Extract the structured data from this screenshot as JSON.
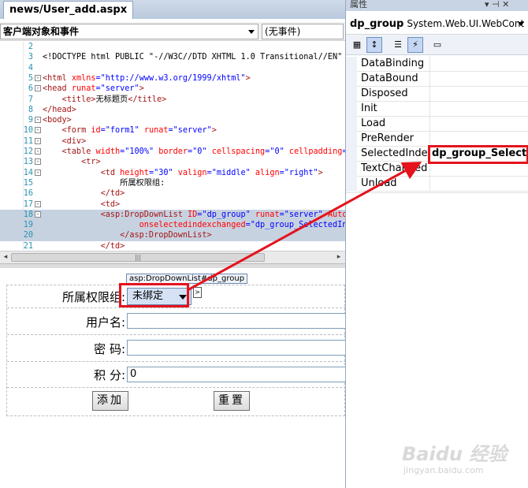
{
  "editor": {
    "tab_title": "news/User_add.aspx",
    "object_dropdown": "客户端对象和事件",
    "event_dropdown": "(无事件)",
    "lines": [
      {
        "num": "2",
        "fold": "",
        "parts": [
          [
            "",
            ""
          ]
        ]
      },
      {
        "num": "3",
        "fold": "",
        "parts": [
          [
            "blk",
            "<!DOCTYPE html PUBLIC \"-//W3C//DTD XHTML 1.0 Transitional//EN\" \""
          ]
        ]
      },
      {
        "num": "4",
        "fold": "",
        "parts": [
          [
            "",
            ""
          ]
        ]
      },
      {
        "num": "5",
        "fold": "-",
        "parts": [
          [
            "tg",
            "<html "
          ],
          [
            "at",
            "xmlns"
          ],
          [
            "bl",
            "="
          ],
          [
            "st",
            "\"http://www.w3.org/1999/xhtml\""
          ],
          [
            "tg",
            ">"
          ]
        ]
      },
      {
        "num": "6",
        "fold": "-",
        "parts": [
          [
            "tg",
            "<head "
          ],
          [
            "at",
            "runat"
          ],
          [
            "bl",
            "="
          ],
          [
            "st",
            "\"server\""
          ],
          [
            "tg",
            ">"
          ]
        ]
      },
      {
        "num": "7",
        "fold": "",
        "parts": [
          [
            "tg",
            "    <title>"
          ],
          [
            "blk",
            "无标题页"
          ],
          [
            "tg",
            "</title>"
          ]
        ]
      },
      {
        "num": "8",
        "fold": "",
        "parts": [
          [
            "tg",
            "</head>"
          ]
        ]
      },
      {
        "num": "9",
        "fold": "-",
        "parts": [
          [
            "tg",
            "<body>"
          ]
        ]
      },
      {
        "num": "10",
        "fold": "-",
        "parts": [
          [
            "tg",
            "    <form "
          ],
          [
            "at",
            "id"
          ],
          [
            "bl",
            "="
          ],
          [
            "st",
            "\"form1\" "
          ],
          [
            "at",
            "runat"
          ],
          [
            "bl",
            "="
          ],
          [
            "st",
            "\"server\""
          ],
          [
            "tg",
            ">"
          ]
        ]
      },
      {
        "num": "11",
        "fold": "-",
        "parts": [
          [
            "tg",
            "    <div>"
          ]
        ]
      },
      {
        "num": "12",
        "fold": "-",
        "parts": [
          [
            "tg",
            "    <table "
          ],
          [
            "at",
            "width"
          ],
          [
            "bl",
            "="
          ],
          [
            "st",
            "\"100%\" "
          ],
          [
            "at",
            "border"
          ],
          [
            "bl",
            "="
          ],
          [
            "st",
            "\"0\" "
          ],
          [
            "at",
            "cellspacing"
          ],
          [
            "bl",
            "="
          ],
          [
            "st",
            "\"0\" "
          ],
          [
            "at",
            "cellpadding"
          ],
          [
            "bl",
            "=\""
          ]
        ]
      },
      {
        "num": "13",
        "fold": "-",
        "parts": [
          [
            "tg",
            "        <tr>"
          ]
        ]
      },
      {
        "num": "14",
        "fold": "-",
        "parts": [
          [
            "tg",
            "            <td "
          ],
          [
            "at",
            "height"
          ],
          [
            "bl",
            "="
          ],
          [
            "st",
            "\"30\" "
          ],
          [
            "at",
            "valign"
          ],
          [
            "bl",
            "="
          ],
          [
            "st",
            "\"middle\" "
          ],
          [
            "at",
            "align"
          ],
          [
            "bl",
            "="
          ],
          [
            "st",
            "\"right\""
          ],
          [
            "tg",
            ">"
          ]
        ]
      },
      {
        "num": "15",
        "fold": "",
        "parts": [
          [
            "blk",
            "                所属权限组:"
          ]
        ]
      },
      {
        "num": "16",
        "fold": "",
        "parts": [
          [
            "tg",
            "            </td>"
          ]
        ]
      },
      {
        "num": "17",
        "fold": "-",
        "parts": [
          [
            "tg",
            "            <td>"
          ]
        ]
      },
      {
        "num": "18",
        "fold": "-",
        "hl": true,
        "parts": [
          [
            "tg",
            "            <asp:DropDownList "
          ],
          [
            "at",
            "ID"
          ],
          [
            "bl",
            "="
          ],
          [
            "st",
            "\"dp_group\" "
          ],
          [
            "at",
            "runat"
          ],
          [
            "bl",
            "="
          ],
          [
            "st",
            "\"server\" "
          ],
          [
            "at",
            "AutoP"
          ]
        ]
      },
      {
        "num": "19",
        "fold": "",
        "hl": true,
        "parts": [
          [
            "at",
            "                    onselectedindexchanged"
          ],
          [
            "bl",
            "="
          ],
          [
            "st",
            "\"dp_group_SelectedInd"
          ]
        ]
      },
      {
        "num": "20",
        "fold": "",
        "hl": true,
        "parts": [
          [
            "tg",
            "                </asp:DropDownList>"
          ]
        ]
      },
      {
        "num": "21",
        "fold": "",
        "parts": [
          [
            "tg",
            "            </td>"
          ]
        ]
      }
    ]
  },
  "design": {
    "tag_tooltip": "asp:DropDownList#dp_group",
    "group_label": "所属权限组:",
    "group_value": "未绑定",
    "user_label": "用户名:",
    "user_value": "",
    "pwd_label": "密 码:",
    "pwd_value": "",
    "score_label": "积 分:",
    "score_value": "0",
    "add_button": "添加",
    "reset_button": "重置",
    "small_tag": ">"
  },
  "properties": {
    "panel_title": "属性",
    "pin_glyph": "▾ ⊣ ✕",
    "object_name": "dp_group",
    "object_type": "System.Web.UI.WebCont",
    "rows": [
      {
        "name": "DataBinding",
        "value": ""
      },
      {
        "name": "DataBound",
        "value": ""
      },
      {
        "name": "Disposed",
        "value": ""
      },
      {
        "name": "Init",
        "value": ""
      },
      {
        "name": "Load",
        "value": ""
      },
      {
        "name": "PreRender",
        "value": ""
      },
      {
        "name": "SelectedIndexC",
        "value": "dp_group_Selected"
      },
      {
        "name": "TextChanged",
        "value": ""
      },
      {
        "name": "Unload",
        "value": ""
      }
    ]
  },
  "watermark": {
    "logo": "Baidu 经验",
    "url": "jingyan.baidu.com"
  },
  "colors": {
    "highlight": "#e4131c",
    "code_tag": "#a31515",
    "code_attr": "#ff0000",
    "code_value": "#0000ff"
  }
}
